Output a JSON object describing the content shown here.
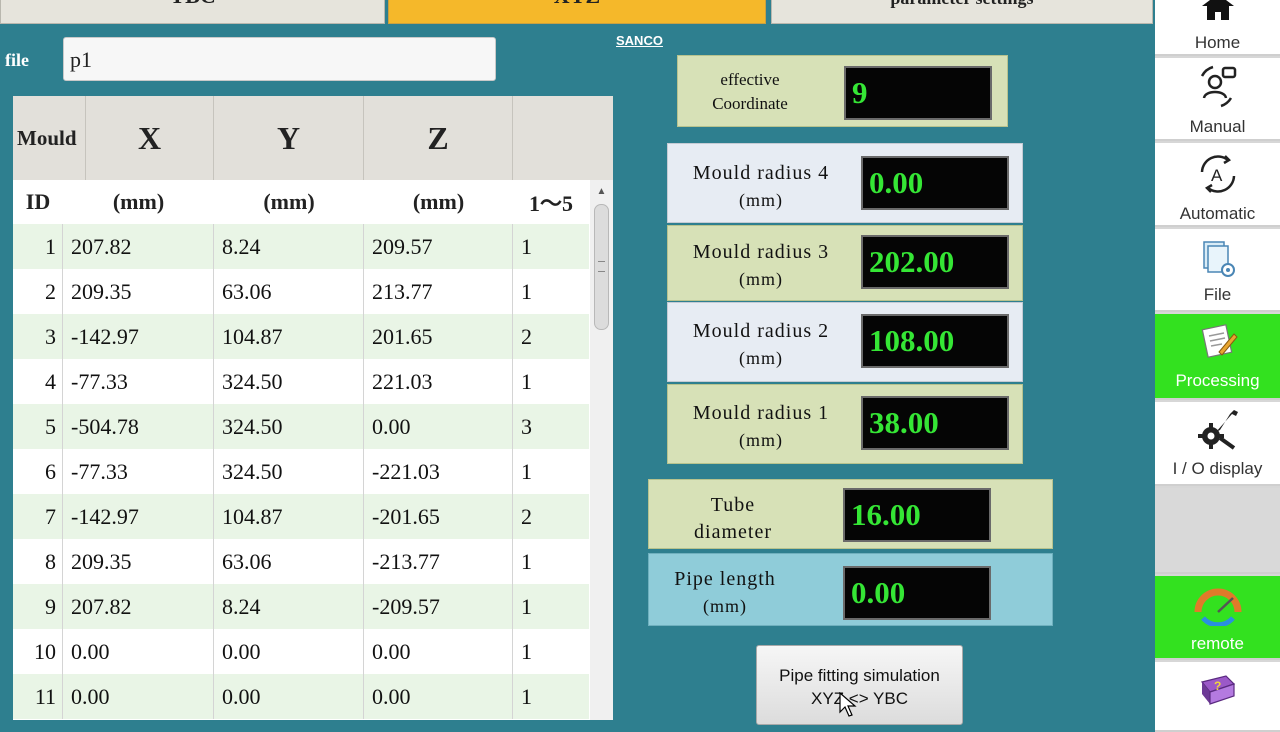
{
  "tabs": {
    "ybc": "YBC",
    "xyz": "XYZ",
    "param": "parameter settings"
  },
  "file": {
    "label": "file",
    "value": "p1"
  },
  "brand": "SANCO",
  "table": {
    "headers": {
      "mould": "Mould",
      "x": "X",
      "y": "Y",
      "z": "Z"
    },
    "subheaders": {
      "id": "ID",
      "x": "(mm)",
      "y": "(mm)",
      "z": "(mm)",
      "range": "1～5"
    },
    "rows": [
      {
        "id": "1",
        "x": "207.82",
        "y": "8.24",
        "z": "209.57",
        "m": "1"
      },
      {
        "id": "2",
        "x": "209.35",
        "y": "63.06",
        "z": "213.77",
        "m": "1"
      },
      {
        "id": "3",
        "x": "-142.97",
        "y": "104.87",
        "z": "201.65",
        "m": "2"
      },
      {
        "id": "4",
        "x": "-77.33",
        "y": "324.50",
        "z": "221.03",
        "m": "1"
      },
      {
        "id": "5",
        "x": "-504.78",
        "y": "324.50",
        "z": "0.00",
        "m": "3"
      },
      {
        "id": "6",
        "x": "-77.33",
        "y": "324.50",
        "z": "-221.03",
        "m": "1"
      },
      {
        "id": "7",
        "x": "-142.97",
        "y": "104.87",
        "z": "-201.65",
        "m": "2"
      },
      {
        "id": "8",
        "x": "209.35",
        "y": "63.06",
        "z": "-213.77",
        "m": "1"
      },
      {
        "id": "9",
        "x": "207.82",
        "y": "8.24",
        "z": "-209.57",
        "m": "1"
      },
      {
        "id": "10",
        "x": "0.00",
        "y": "0.00",
        "z": "0.00",
        "m": "1"
      },
      {
        "id": "11",
        "x": "0.00",
        "y": "0.00",
        "z": "0.00",
        "m": "1"
      }
    ]
  },
  "params": {
    "effective": {
      "line1": "effective",
      "line2": "Coordinate",
      "value": "9"
    },
    "r4": {
      "line1": "Mould radius 4",
      "line2": "(mm)",
      "value": "0.00"
    },
    "r3": {
      "line1": "Mould radius 3",
      "line2": "(mm)",
      "value": "202.00"
    },
    "r2": {
      "line1": "Mould radius 2",
      "line2": "(mm)",
      "value": "108.00"
    },
    "r1": {
      "line1": "Mould radius 1",
      "line2": "(mm)",
      "value": "38.00"
    },
    "tube": {
      "line1": "Tube",
      "line2": "diameter",
      "value": "16.00"
    },
    "pipe": {
      "line1": "Pipe length",
      "line2": "(mm)",
      "value": "0.00"
    }
  },
  "simulation_button": {
    "line1": "Pipe fitting simulation",
    "line2": "XYZ <> YBC"
  },
  "nav": {
    "home": "Home",
    "manual": "Manual",
    "automatic": "Automatic",
    "file": "File",
    "processing": "Processing",
    "io": "I / O display",
    "remote": "remote"
  },
  "colors": {
    "background": "#2e7f8f",
    "active_tab": "#f5b82a",
    "lcd_text": "#35e635",
    "active_nav": "#33e11f"
  }
}
